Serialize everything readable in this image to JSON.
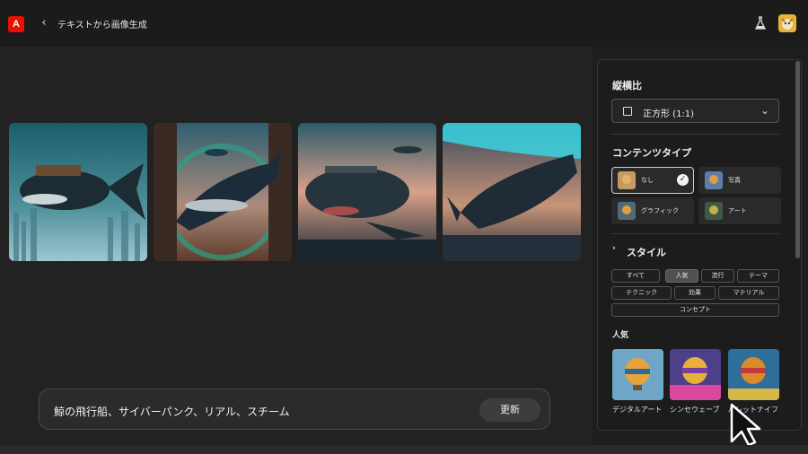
{
  "header": {
    "logo_letter": "A",
    "back_glyph": "‹",
    "title": "テキストから画像生成",
    "lab_icon": "flask-icon",
    "avatar": "user-avatar"
  },
  "images": [
    {
      "alt": "whale-airship-1"
    },
    {
      "alt": "whale-airship-2"
    },
    {
      "alt": "whale-airship-3"
    },
    {
      "alt": "whale-airship-4"
    }
  ],
  "prompt": {
    "text": "鯨の飛行船、サイバーパンク、リアル、スチーム",
    "button": "更新"
  },
  "panel": {
    "aspect": {
      "heading": "縦横比",
      "value": "正方形 (1:1)"
    },
    "content_type": {
      "heading": "コンテンツタイプ",
      "options": [
        {
          "label": "なし",
          "selected": true
        },
        {
          "label": "写真",
          "selected": false
        },
        {
          "label": "グラフィック",
          "selected": false
        },
        {
          "label": "アート",
          "selected": false
        }
      ]
    },
    "style": {
      "heading": "スタイル",
      "chips": [
        "すべて",
        "人気",
        "流行",
        "テーマ",
        "テクニック",
        "効果",
        "マテリアル",
        "コンセプト"
      ],
      "active": "人気"
    },
    "popular": {
      "heading": "人気",
      "items": [
        "デジタルアート",
        "シンセウェーブ",
        "パレットナイフ"
      ]
    }
  },
  "colors": {
    "accent": "#eb1000",
    "background": "#1e1e1e",
    "panel": "#1c1c1c"
  }
}
